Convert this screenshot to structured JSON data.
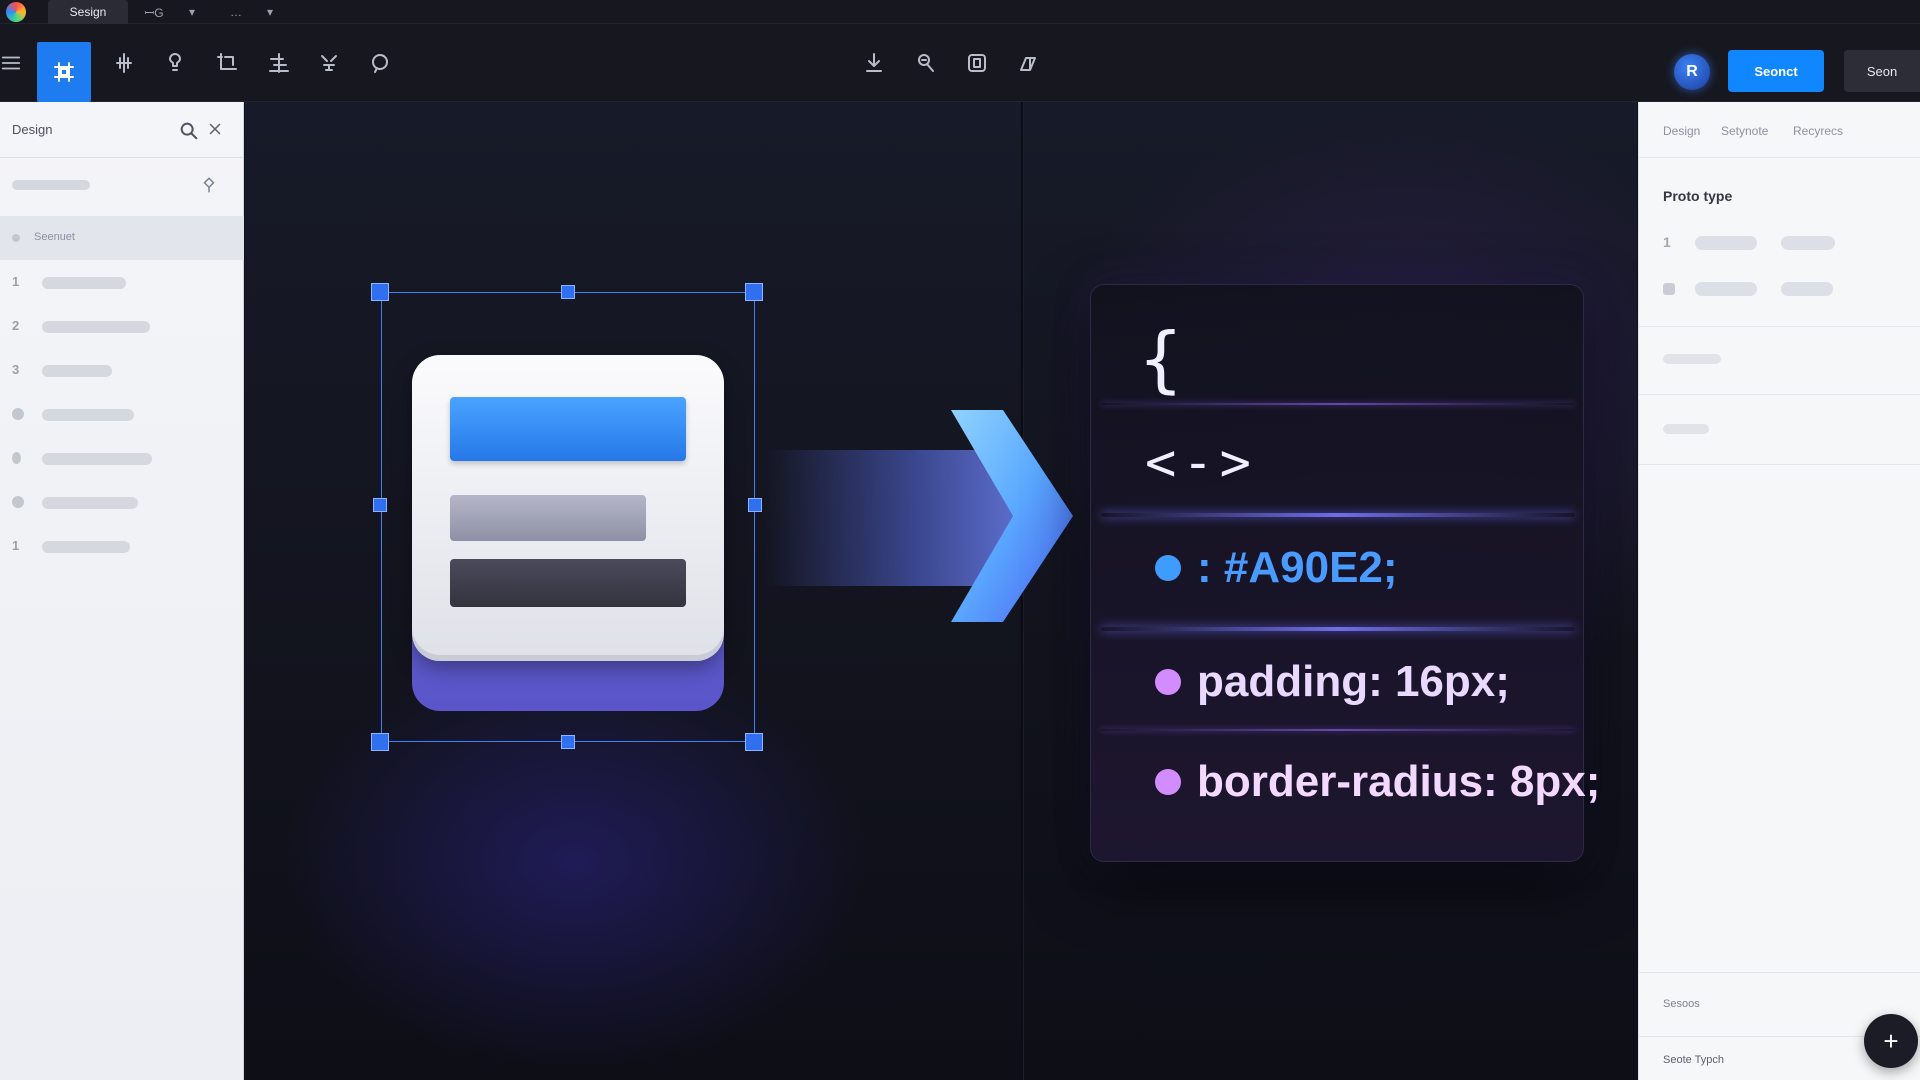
{
  "titlebar": {
    "tabs": [
      {
        "label": "Sesign",
        "active": true
      },
      {
        "label": "ꟷG",
        "active": false
      },
      {
        "label": "▾",
        "active": false
      },
      {
        "label": "…",
        "active": false
      },
      {
        "label": "▾",
        "active": false
      }
    ]
  },
  "toolbar": {
    "tools": [
      "menu-icon",
      "frame-icon",
      "move-icon",
      "brush-icon",
      "crop-icon",
      "align-icon",
      "transform-icon",
      "lasso-icon"
    ],
    "center_tools": [
      "download-icon",
      "inspect-icon",
      "component-icon",
      "share-icon"
    ],
    "avatar_letter": "R",
    "primary_button": "Seonct",
    "secondary_button": "Seon"
  },
  "left_panel": {
    "title": "Design",
    "selected_layer": "Seenuet",
    "layers": [
      {
        "marker": "1"
      },
      {
        "marker": "2"
      },
      {
        "marker": "3"
      },
      {
        "marker": ""
      },
      {
        "marker": ""
      },
      {
        "marker": ""
      },
      {
        "marker": "1"
      }
    ]
  },
  "canvas": {
    "code": {
      "brace": "{",
      "tag": "<->",
      "lines": [
        {
          "text": ": #A90E2;",
          "bullet_color": "#3f9cff"
        },
        {
          "text": "padding: 16px;",
          "bullet_color": "#d28cff"
        },
        {
          "text": "border-radius: 8px;",
          "bullet_color": "#d28cff"
        }
      ]
    },
    "colors": {
      "accent": "#1f7bf0",
      "selection": "#3b82f6",
      "card_base": "#5a55c9"
    }
  },
  "right_panel": {
    "tabs": [
      "Design",
      "Setynote",
      "Recyrecs"
    ],
    "heading": "Proto type",
    "rows": [
      {
        "marker": "1"
      },
      {
        "marker": ""
      }
    ],
    "footer_label_1": "Sesoos",
    "footer_label_2": "Seote Typch",
    "fab_label": "+"
  }
}
